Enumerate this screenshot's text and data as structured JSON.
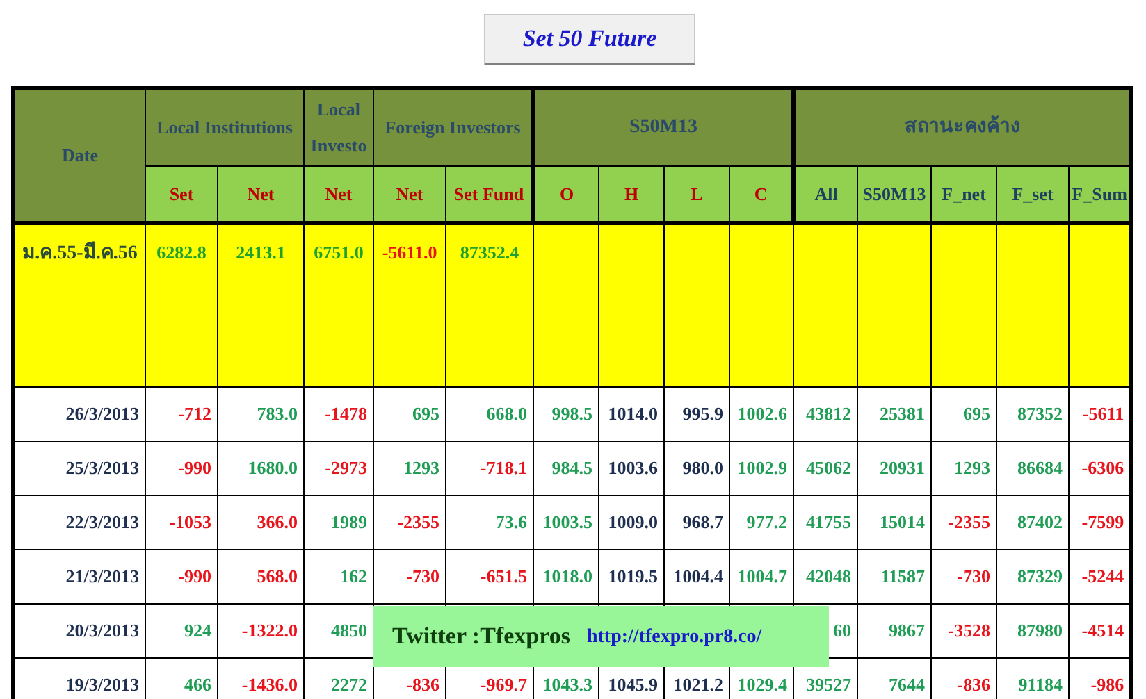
{
  "title_button": "Set 50  Future",
  "group_headers": [
    {
      "label": "Date"
    },
    {
      "label": "Local Institutions"
    },
    {
      "label": "Local Investo"
    },
    {
      "label": "Foreign Investors"
    },
    {
      "label": "S50M13"
    },
    {
      "label": "สถานะคงค้าง"
    }
  ],
  "columns": [
    {
      "label": "Set",
      "kind": "red"
    },
    {
      "label": "Net",
      "kind": "red"
    },
    {
      "label": "Net",
      "kind": "red"
    },
    {
      "label": "Net",
      "kind": "red"
    },
    {
      "label": "Set Fund",
      "kind": "red"
    },
    {
      "label": "O",
      "kind": "red"
    },
    {
      "label": "H",
      "kind": "red"
    },
    {
      "label": "L",
      "kind": "red"
    },
    {
      "label": "C",
      "kind": "red"
    },
    {
      "label": "All",
      "kind": "dark"
    },
    {
      "label": "S50M13",
      "kind": "dark"
    },
    {
      "label": "F_net",
      "kind": "dark"
    },
    {
      "label": "F_set",
      "kind": "dark"
    },
    {
      "label": "F_Sum",
      "kind": "dark"
    }
  ],
  "summary_row": {
    "period": "ม.ค.55-มี.ค.56",
    "cells": [
      {
        "text": "6282.8",
        "color": "#1fa02f"
      },
      {
        "text": "2413.1",
        "color": "#1fa02f"
      },
      {
        "text": "6751.0",
        "color": "#1fa02f"
      },
      {
        "text": "-5611.0",
        "color": "#e8141c"
      },
      {
        "text": "87352.4",
        "color": "#1fa02f"
      }
    ]
  },
  "rows": [
    {
      "date": "26/3/2013",
      "cells": [
        {
          "text": "-712",
          "color": "#e8141c"
        },
        {
          "text": "783.0",
          "color": "#1f9d55"
        },
        {
          "text": "-1478",
          "color": "#e8141c"
        },
        {
          "text": "695",
          "color": "#1f9d55"
        },
        {
          "text": "668.0",
          "color": "#1f9d55"
        },
        {
          "text": "998.5",
          "color": "#1f9d55"
        },
        {
          "text": "1014.0",
          "color": "#1f2f4f"
        },
        {
          "text": "995.9",
          "color": "#1f2f4f"
        },
        {
          "text": "1002.6",
          "color": "#1f9d55"
        },
        {
          "text": "43812",
          "color": "#1f9d55"
        },
        {
          "text": "25381",
          "color": "#1f9d55"
        },
        {
          "text": "695",
          "color": "#1f9d55"
        },
        {
          "text": "87352",
          "color": "#1f9d55"
        },
        {
          "text": "-5611",
          "color": "#e8141c"
        }
      ]
    },
    {
      "date": "25/3/2013",
      "cells": [
        {
          "text": "-990",
          "color": "#e8141c"
        },
        {
          "text": "1680.0",
          "color": "#1f9d55"
        },
        {
          "text": "-2973",
          "color": "#e8141c"
        },
        {
          "text": "1293",
          "color": "#1f9d55"
        },
        {
          "text": "-718.1",
          "color": "#e8141c"
        },
        {
          "text": "984.5",
          "color": "#1f9d55"
        },
        {
          "text": "1003.6",
          "color": "#1f2f4f"
        },
        {
          "text": "980.0",
          "color": "#1f2f4f"
        },
        {
          "text": "1002.9",
          "color": "#1f9d55"
        },
        {
          "text": "45062",
          "color": "#1f9d55"
        },
        {
          "text": "20931",
          "color": "#1f9d55"
        },
        {
          "text": "1293",
          "color": "#1f9d55"
        },
        {
          "text": "86684",
          "color": "#1f9d55"
        },
        {
          "text": "-6306",
          "color": "#e8141c"
        }
      ]
    },
    {
      "date": "22/3/2013",
      "cells": [
        {
          "text": "-1053",
          "color": "#e8141c"
        },
        {
          "text": "366.0",
          "color": "#e8141c"
        },
        {
          "text": "1989",
          "color": "#1f9d55"
        },
        {
          "text": "-2355",
          "color": "#e8141c"
        },
        {
          "text": "73.6",
          "color": "#1f9d55"
        },
        {
          "text": "1003.5",
          "color": "#1f9d55"
        },
        {
          "text": "1009.0",
          "color": "#1f2f4f"
        },
        {
          "text": "968.7",
          "color": "#1f2f4f"
        },
        {
          "text": "977.2",
          "color": "#1f9d55"
        },
        {
          "text": "41755",
          "color": "#1f9d55"
        },
        {
          "text": "15014",
          "color": "#1f9d55"
        },
        {
          "text": "-2355",
          "color": "#e8141c"
        },
        {
          "text": "87402",
          "color": "#1f9d55"
        },
        {
          "text": "-7599",
          "color": "#e8141c"
        }
      ]
    },
    {
      "date": "21/3/2013",
      "cells": [
        {
          "text": "-990",
          "color": "#e8141c"
        },
        {
          "text": "568.0",
          "color": "#e8141c"
        },
        {
          "text": "162",
          "color": "#1f9d55"
        },
        {
          "text": "-730",
          "color": "#e8141c"
        },
        {
          "text": "-651.5",
          "color": "#e8141c"
        },
        {
          "text": "1018.0",
          "color": "#1f9d55"
        },
        {
          "text": "1019.5",
          "color": "#1f2f4f"
        },
        {
          "text": "1004.4",
          "color": "#1f2f4f"
        },
        {
          "text": "1004.7",
          "color": "#1f9d55"
        },
        {
          "text": "42048",
          "color": "#1f9d55"
        },
        {
          "text": "11587",
          "color": "#1f9d55"
        },
        {
          "text": "-730",
          "color": "#e8141c"
        },
        {
          "text": "87329",
          "color": "#1f9d55"
        },
        {
          "text": "-5244",
          "color": "#e8141c"
        }
      ]
    },
    {
      "date": "20/3/2013",
      "cells": [
        {
          "text": "924",
          "color": "#1f9d55"
        },
        {
          "text": "-1322.0",
          "color": "#e8141c"
        },
        {
          "text": "4850",
          "color": "#1f9d55"
        },
        null,
        null,
        null,
        null,
        null,
        null,
        {
          "text": "60",
          "color": "#1f9d55"
        },
        {
          "text": "9867",
          "color": "#1f9d55"
        },
        {
          "text": "-3528",
          "color": "#e8141c"
        },
        {
          "text": "87980",
          "color": "#1f9d55"
        },
        {
          "text": "-4514",
          "color": "#e8141c"
        }
      ]
    },
    {
      "date": "19/3/2013",
      "cells": [
        {
          "text": "466",
          "color": "#1f9d55"
        },
        {
          "text": "-1436.0",
          "color": "#e8141c"
        },
        {
          "text": "2272",
          "color": "#1f9d55"
        },
        {
          "text": "-836",
          "color": "#e8141c"
        },
        {
          "text": "-969.7",
          "color": "#e8141c"
        },
        {
          "text": "1043.3",
          "color": "#1f9d55"
        },
        {
          "text": "1045.9",
          "color": "#1f2f4f"
        },
        {
          "text": "1021.2",
          "color": "#1f2f4f"
        },
        {
          "text": "1029.4",
          "color": "#1f9d55"
        },
        {
          "text": "39527",
          "color": "#1f9d55"
        },
        {
          "text": "7644",
          "color": "#1f9d55"
        },
        {
          "text": "-836",
          "color": "#e8141c"
        },
        {
          "text": "91184",
          "color": "#1f9d55"
        },
        {
          "text": "-986",
          "color": "#e8141c"
        }
      ]
    }
  ],
  "banner": {
    "handle": "Twitter :Tfexpros",
    "link": "http://tfexpro.pr8.co/"
  }
}
